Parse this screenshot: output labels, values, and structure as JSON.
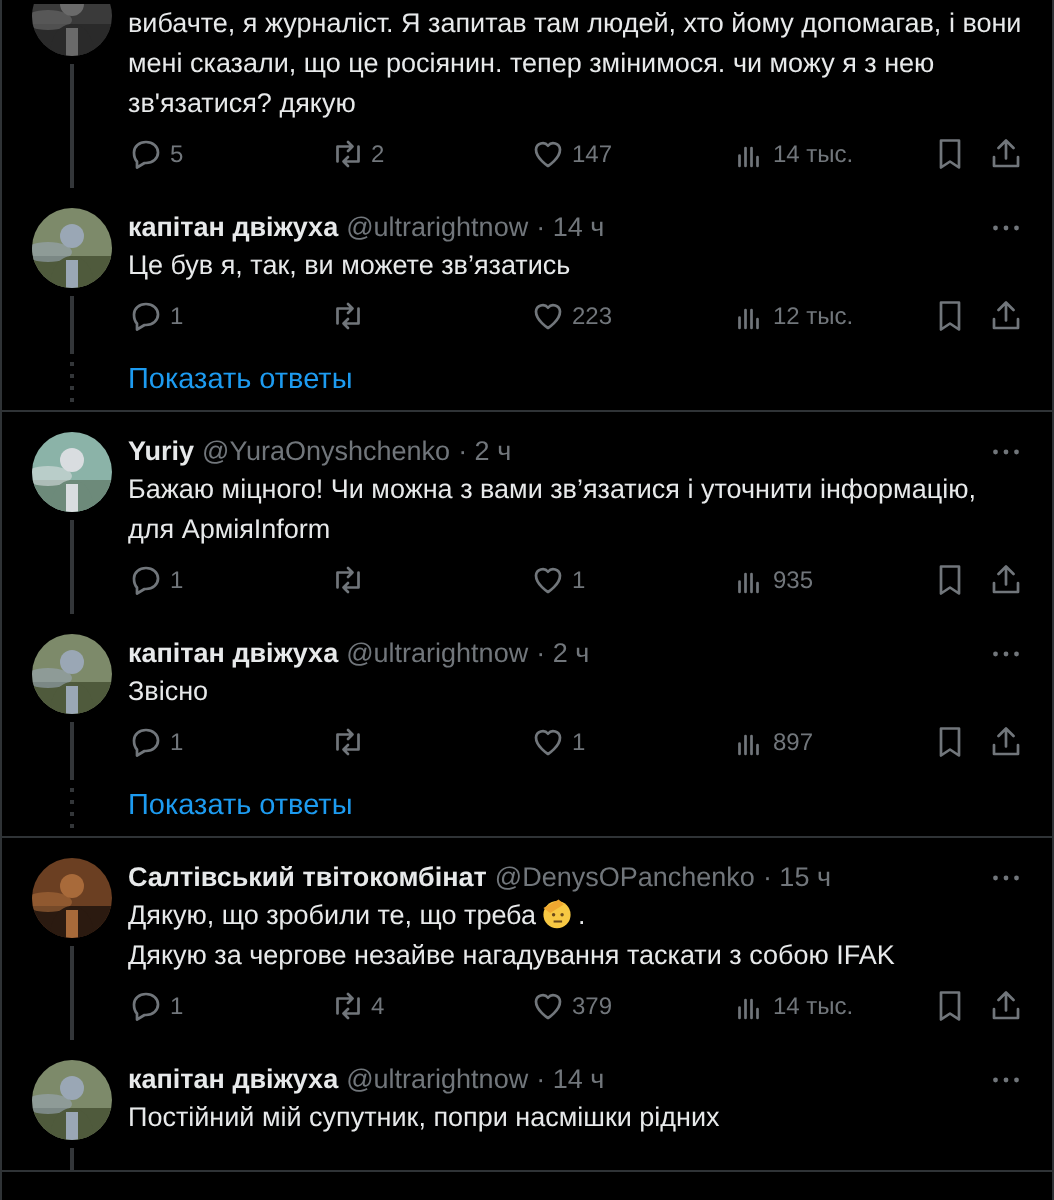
{
  "threads": [
    {
      "tweets": [
        {
          "header_cut": true,
          "body": [
            {
              "text": "вибачте, я журналіст. Я запитав там людей, хто йому допомагав, і вони мені сказали, що це росіянин. тепер змінимося. чи можу я з нею зв'язатися? дякую"
            }
          ],
          "replies": "5",
          "reposts": "2",
          "likes": "147",
          "views": "14 тыс."
        },
        {
          "header_cut": false,
          "name": "капітан двіжуха",
          "handle": "@ultrarightnow",
          "time": "· 14 ч",
          "body": [
            {
              "text": "Це був я, так, ви можете зв’язатись"
            }
          ],
          "replies": "1",
          "likes": "223",
          "views": "12 тыс."
        }
      ],
      "show_replies": "Показать ответы"
    },
    {
      "tweets": [
        {
          "header_cut": false,
          "name": "Yuriy",
          "handle": "@YuraOnyshchenko",
          "time": "· 2 ч",
          "body": [
            {
              "text": "Бажаю міцного! Чи можна з вами зв’язатися і уточнити інформацію, для АрміяInform"
            }
          ],
          "replies": "1",
          "likes": "1",
          "views": "935"
        },
        {
          "header_cut": false,
          "name": "капітан двіжуха",
          "handle": "@ultrarightnow",
          "time": "· 2 ч",
          "body": [
            {
              "text": "Звісно"
            }
          ],
          "replies": "1",
          "likes": "1",
          "views": "897"
        }
      ],
      "show_replies": "Показать ответы"
    },
    {
      "tweets": [
        {
          "header_cut": false,
          "name": "Салтівський твітокомбінат",
          "handle": "@DenysOPanchenko",
          "time": "· 15 ч",
          "body": [
            {
              "kind": "salute-emoji",
              "text": "Дякую, що зробили те, що треба",
              "after": "."
            },
            {
              "text": "Дякую за чергове незайве нагадування таскати з собою IFAK"
            }
          ],
          "replies": "1",
          "reposts": "4",
          "likes": "379",
          "views": "14 тыс."
        },
        {
          "header_cut": false,
          "name": "капітан двіжуха",
          "handle": "@ultrarightnow",
          "time": "· 14 ч",
          "body": [
            {
              "text": "Постійний мій супутник, попри насмішки рідних"
            }
          ]
        }
      ]
    }
  ]
}
